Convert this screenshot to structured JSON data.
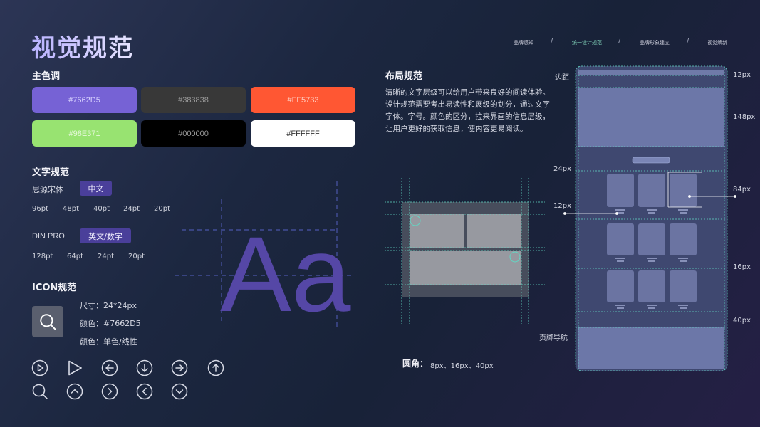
{
  "page": {
    "title": "视觉规范"
  },
  "nav": {
    "items": [
      "品牌感知",
      "统一设计规范",
      "品牌形象建立",
      "视觉焕新"
    ],
    "separator": "/",
    "active_index": 1
  },
  "colors_section": {
    "title": "主色调",
    "swatches": [
      {
        "label": "#7662D5",
        "bg": "#7662D5",
        "fg": "#d9d3ff"
      },
      {
        "label": "#383838",
        "bg": "#383838",
        "fg": "#9a9a9a"
      },
      {
        "label": "#FF5733",
        "bg": "#FF5733",
        "fg": "#ffd0c4"
      },
      {
        "label": "#98E371",
        "bg": "#98E371",
        "fg": "#e6f8da"
      },
      {
        "label": "#000000",
        "bg": "#000000",
        "fg": "#9a9a9a"
      },
      {
        "label": "#FFFFFF",
        "bg": "#FFFFFF",
        "fg": "#333333"
      }
    ]
  },
  "typography": {
    "title": "文字规范",
    "font_cn": {
      "name": "思源宋体",
      "chip": "中文",
      "sizes": [
        "96pt",
        "48pt",
        "40pt",
        "24pt",
        "20pt"
      ]
    },
    "font_en": {
      "name": "DIN PRO",
      "chip": "英文/数字",
      "sizes": [
        "128pt",
        "64pt",
        "24pt",
        "20pt"
      ]
    },
    "sample": "Aa",
    "sample_color": "#5547a6"
  },
  "icon_section": {
    "title": "ICON规范",
    "size": "尺寸：24*24px",
    "color": "颜色：#7662D5",
    "style": "颜色：单色/线性",
    "icons_row1": [
      "play-circle-icon",
      "play-triangle-icon",
      "arrow-left-circle-icon",
      "arrow-down-circle-icon",
      "arrow-right-circle-icon",
      "arrow-up-circle-icon"
    ],
    "icons_row2": [
      "search-icon",
      "chevron-up-circle-icon",
      "chevron-right-circle-icon",
      "chevron-left-circle-icon",
      "chevron-down-circle-icon"
    ]
  },
  "layout_section": {
    "title": "布局规范",
    "description": "清晰的文字层级可以给用户带来良好的间读体验。设计规范需要考出易读性和展级的划分，通过文字字体。字号。颜色的区分，拉来界画的信息层级，让用户更好的获取信息，使内容更易阅读。",
    "radius_label": "圆角：",
    "radius_values": "8px、16px、40px"
  },
  "phone_spec": {
    "margin_label": "边距",
    "footer_label": "页脚导航",
    "left_measures": [
      "24px",
      "12px"
    ],
    "right_measures": [
      "12px",
      "148px",
      "84px",
      "16px",
      "40px"
    ]
  }
}
